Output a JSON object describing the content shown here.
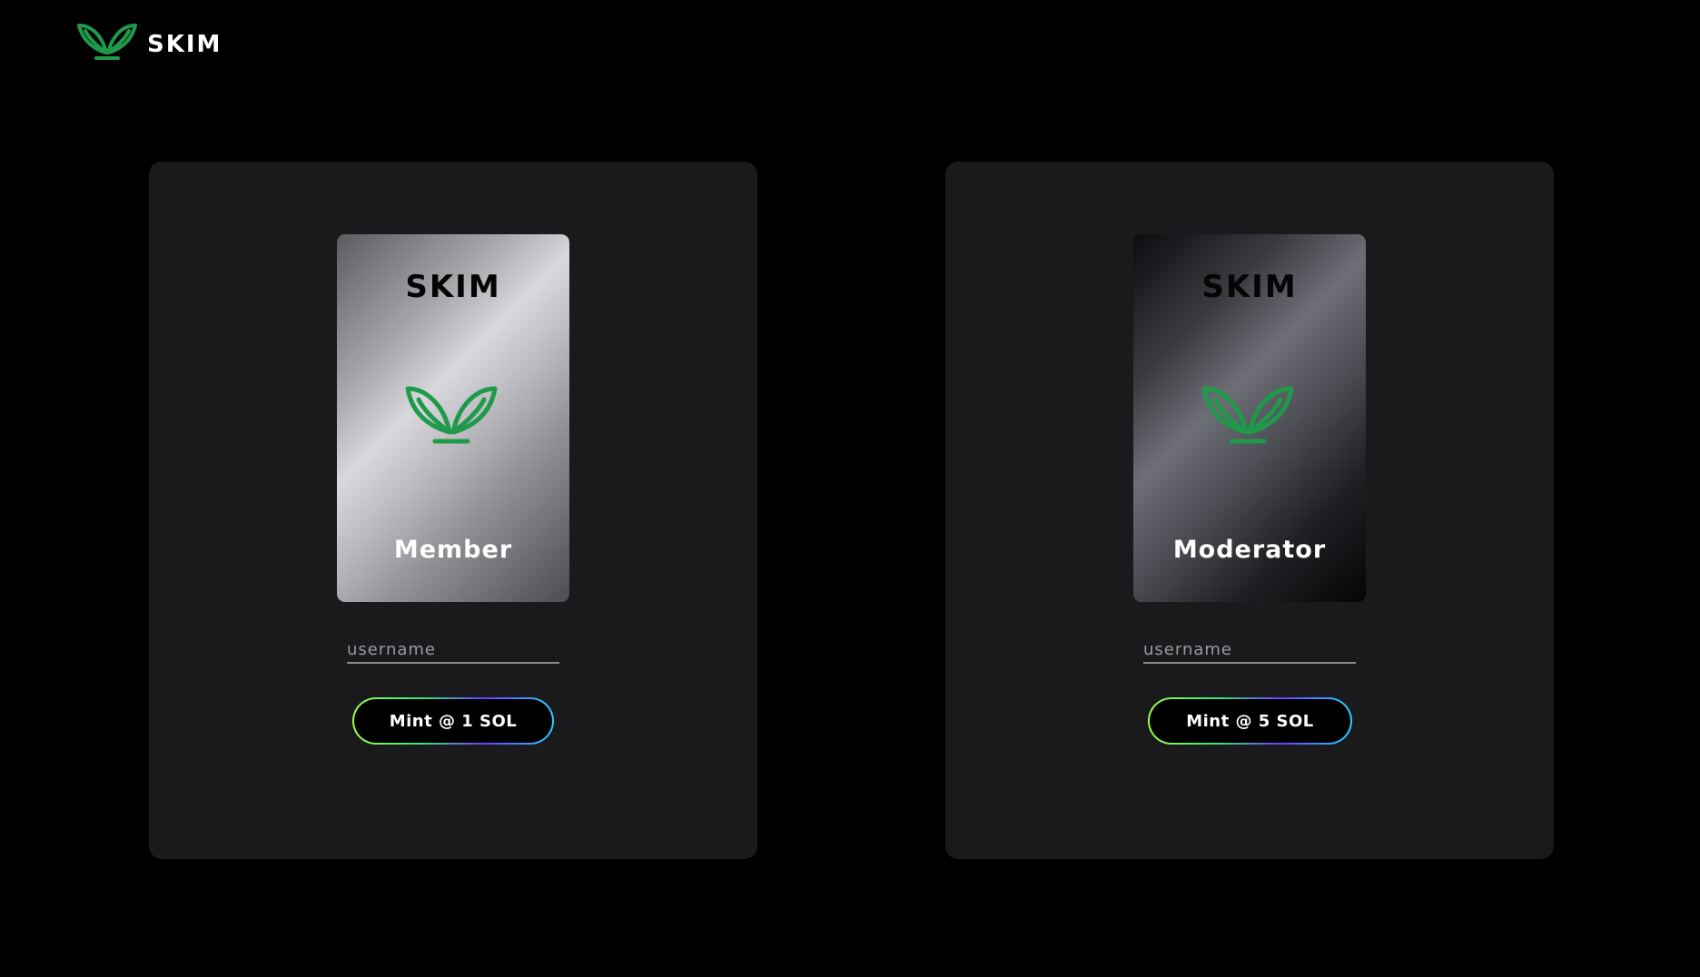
{
  "header": {
    "brand_name": "SKIM",
    "logo_icon": "sprout-leaves-icon",
    "accent_color": "#1f9a4a"
  },
  "tiers": [
    {
      "card_title": "SKIM",
      "card_icon": "sprout-leaves-icon",
      "role": "Member",
      "card_style": "silver",
      "username_placeholder": "username",
      "mint_label": "Mint @ 1 SOL"
    },
    {
      "card_title": "SKIM",
      "card_icon": "sprout-leaves-icon",
      "role": "Moderator",
      "card_style": "dark",
      "username_placeholder": "username",
      "mint_label": "Mint @ 5 SOL"
    }
  ]
}
